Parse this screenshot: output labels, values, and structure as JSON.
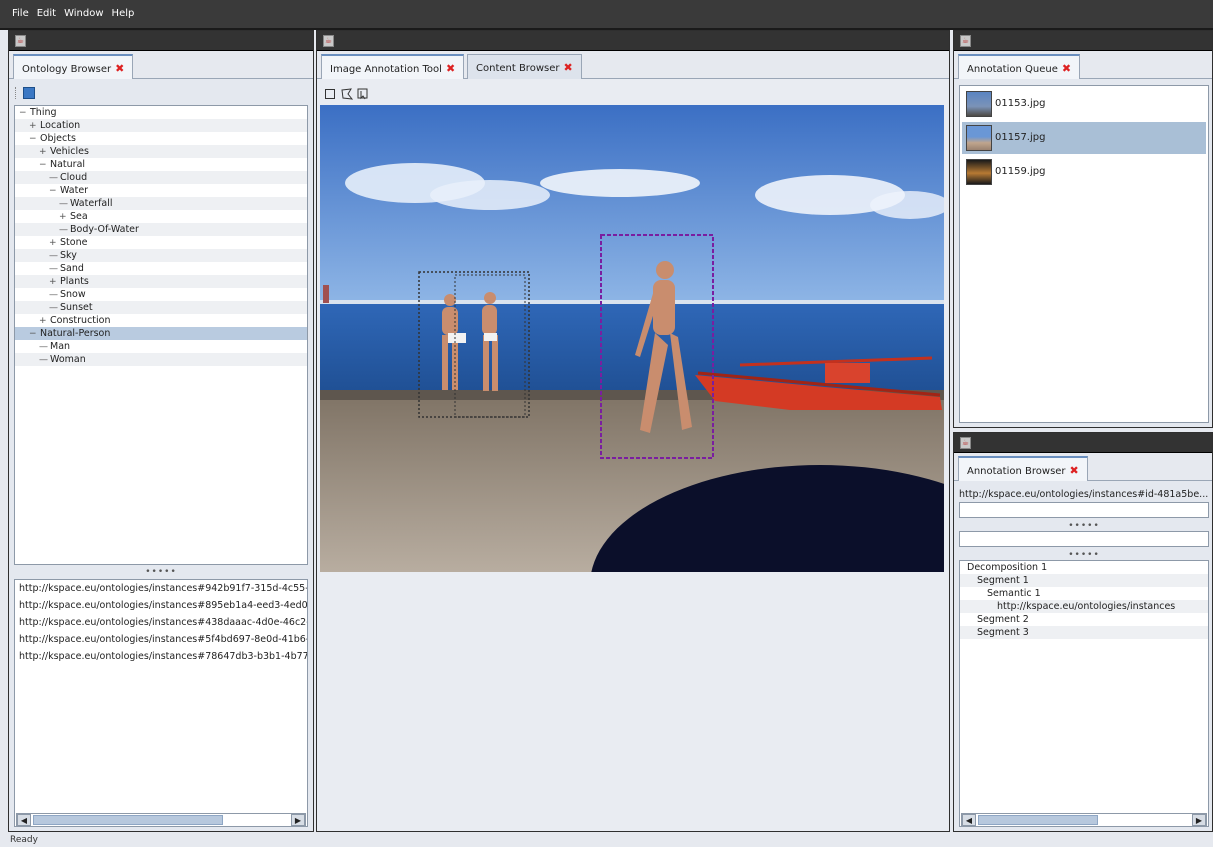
{
  "menu": [
    "File",
    "Edit",
    "Window",
    "Help"
  ],
  "left_panel": {
    "tab": "Ontology Browser",
    "tree": [
      {
        "label": "Thing",
        "level": 0,
        "exp": "−"
      },
      {
        "label": "Location",
        "level": 1,
        "exp": "+"
      },
      {
        "label": "Objects",
        "level": 1,
        "exp": "−"
      },
      {
        "label": "Vehicles",
        "level": 2,
        "exp": "+"
      },
      {
        "label": "Natural",
        "level": 2,
        "exp": "−"
      },
      {
        "label": "Cloud",
        "level": 3,
        "exp": ""
      },
      {
        "label": "Water",
        "level": 3,
        "exp": "−"
      },
      {
        "label": "Waterfall",
        "level": 4,
        "exp": ""
      },
      {
        "label": "Sea",
        "level": 4,
        "exp": "+"
      },
      {
        "label": "Body-Of-Water",
        "level": 4,
        "exp": ""
      },
      {
        "label": "Stone",
        "level": 3,
        "exp": "+"
      },
      {
        "label": "Sky",
        "level": 3,
        "exp": ""
      },
      {
        "label": "Sand",
        "level": 3,
        "exp": ""
      },
      {
        "label": "Plants",
        "level": 3,
        "exp": "+"
      },
      {
        "label": "Snow",
        "level": 3,
        "exp": ""
      },
      {
        "label": "Sunset",
        "level": 3,
        "exp": ""
      },
      {
        "label": "Construction",
        "level": 2,
        "exp": "+"
      },
      {
        "label": "Natural-Person",
        "level": 1,
        "exp": "−",
        "selected": true
      },
      {
        "label": "Man",
        "level": 2,
        "exp": ""
      },
      {
        "label": "Woman",
        "level": 2,
        "exp": ""
      }
    ],
    "splitter": "•••••",
    "uris": [
      "http://kspace.eu/ontologies/instances#942b91f7-315d-4c55-",
      "http://kspace.eu/ontologies/instances#895eb1a4-eed3-4ed0",
      "http://kspace.eu/ontologies/instances#438daaac-4d0e-46c2-",
      "http://kspace.eu/ontologies/instances#5f4bd697-8e0d-41b6-",
      "http://kspace.eu/ontologies/instances#78647db3-b3b1-4b77"
    ]
  },
  "center_panel": {
    "tabs": [
      "Image Annotation Tool",
      "Content Browser"
    ],
    "tools": [
      "rectangle-tool",
      "polygon-tool",
      "select-tool"
    ],
    "regions": [
      {
        "style": "dotted",
        "color": "#333333"
      },
      {
        "style": "dashed",
        "color": "#7a1ea0"
      }
    ]
  },
  "queue_panel": {
    "tab": "Annotation Queue",
    "items": [
      "01153.jpg",
      "01157.jpg",
      "01159.jpg"
    ],
    "selected": "01157.jpg"
  },
  "annotation_panel": {
    "tab": "Annotation Browser",
    "uri": "http://kspace.eu/ontologies/instances#id-481a5be...",
    "splitter": "•••••",
    "tree": [
      {
        "label": "Decomposition 1",
        "level": 0
      },
      {
        "label": "Segment 1",
        "level": 1
      },
      {
        "label": "Semantic 1",
        "level": 2
      },
      {
        "label": "http://kspace.eu/ontologies/instances",
        "level": 3
      },
      {
        "label": "Segment 2",
        "level": 1
      },
      {
        "label": "Segment 3",
        "level": 1
      }
    ]
  },
  "status": "Ready",
  "colors": {
    "tab_close": "#dd2222",
    "selection": "#b9cbe0",
    "region_selected": "#7a1ea0"
  }
}
